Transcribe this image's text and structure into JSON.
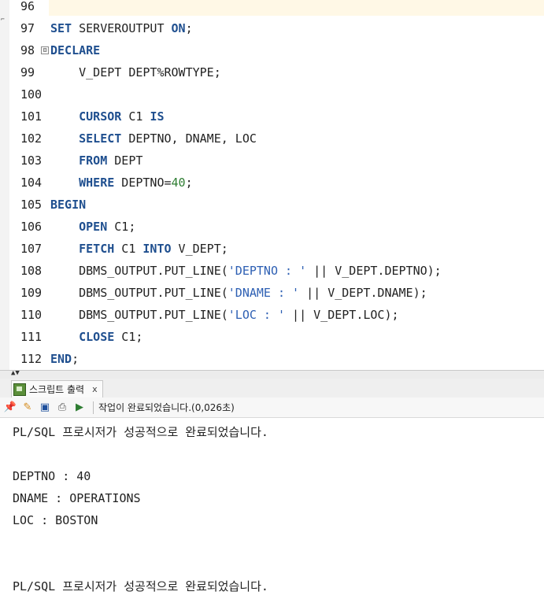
{
  "editor": {
    "lines": [
      {
        "num": "96",
        "segments": []
      },
      {
        "num": "97",
        "segments": [
          {
            "t": "SET",
            "c": "kw"
          },
          {
            "t": " SERVEROUTPUT ",
            "c": ""
          },
          {
            "t": "ON",
            "c": "kw"
          },
          {
            "t": ";",
            "c": ""
          }
        ]
      },
      {
        "num": "98",
        "segments": [
          {
            "t": "DECLARE",
            "c": "kw"
          }
        ]
      },
      {
        "num": "99",
        "segments": [
          {
            "t": "    V_DEPT DEPT%ROWTYPE;",
            "c": ""
          }
        ]
      },
      {
        "num": "100",
        "segments": []
      },
      {
        "num": "101",
        "segments": [
          {
            "t": "    ",
            "c": ""
          },
          {
            "t": "CURSOR",
            "c": "kw"
          },
          {
            "t": " C1 ",
            "c": ""
          },
          {
            "t": "IS",
            "c": "kw"
          }
        ]
      },
      {
        "num": "102",
        "segments": [
          {
            "t": "    ",
            "c": ""
          },
          {
            "t": "SELECT",
            "c": "kw"
          },
          {
            "t": " DEPTNO, DNAME, LOC",
            "c": ""
          }
        ]
      },
      {
        "num": "103",
        "segments": [
          {
            "t": "    ",
            "c": ""
          },
          {
            "t": "FROM",
            "c": "kw"
          },
          {
            "t": " DEPT",
            "c": ""
          }
        ]
      },
      {
        "num": "104",
        "segments": [
          {
            "t": "    ",
            "c": ""
          },
          {
            "t": "WHERE",
            "c": "kw"
          },
          {
            "t": " DEPTNO=",
            "c": ""
          },
          {
            "t": "40",
            "c": "num"
          },
          {
            "t": ";",
            "c": ""
          }
        ]
      },
      {
        "num": "105",
        "segments": [
          {
            "t": "BEGIN",
            "c": "kw"
          }
        ]
      },
      {
        "num": "106",
        "segments": [
          {
            "t": "    ",
            "c": ""
          },
          {
            "t": "OPEN",
            "c": "kw"
          },
          {
            "t": " C1;",
            "c": ""
          }
        ]
      },
      {
        "num": "107",
        "segments": [
          {
            "t": "    ",
            "c": ""
          },
          {
            "t": "FETCH",
            "c": "kw"
          },
          {
            "t": " C1 ",
            "c": ""
          },
          {
            "t": "INTO",
            "c": "kw"
          },
          {
            "t": " V_DEPT;",
            "c": ""
          }
        ]
      },
      {
        "num": "108",
        "segments": [
          {
            "t": "    DBMS_OUTPUT.PUT_LINE(",
            "c": ""
          },
          {
            "t": "'DEPTNO : '",
            "c": "str"
          },
          {
            "t": " || V_DEPT.DEPTNO);",
            "c": ""
          }
        ]
      },
      {
        "num": "109",
        "segments": [
          {
            "t": "    DBMS_OUTPUT.PUT_LINE(",
            "c": ""
          },
          {
            "t": "'DNAME : '",
            "c": "str"
          },
          {
            "t": " || V_DEPT.DNAME);",
            "c": ""
          }
        ]
      },
      {
        "num": "110",
        "segments": [
          {
            "t": "    DBMS_OUTPUT.PUT_LINE(",
            "c": ""
          },
          {
            "t": "'LOC : '",
            "c": "str"
          },
          {
            "t": " || V_DEPT.LOC);",
            "c": ""
          }
        ]
      },
      {
        "num": "111",
        "segments": [
          {
            "t": "    ",
            "c": ""
          },
          {
            "t": "CLOSE",
            "c": "kw"
          },
          {
            "t": " C1;",
            "c": ""
          }
        ]
      },
      {
        "num": "112",
        "segments": [
          {
            "t": "END",
            "c": "kw"
          },
          {
            "t": ";",
            "c": ""
          }
        ]
      }
    ],
    "fold_marker": "⊟",
    "colors": {
      "keyword": "#1f4f8f",
      "string": "#2d5fb3",
      "number": "#2e7d32",
      "current_line": "#fff8e6"
    }
  },
  "panel": {
    "tab_label": "스크립트 출력",
    "tab_close": "x",
    "status_text": "작업이 완료되었습니다.(0,026초)",
    "toolbar_icons": [
      "pin-icon",
      "eraser-icon",
      "save-icon",
      "print-icon",
      "run-icon"
    ]
  },
  "output": {
    "lines": [
      "PL/SQL 프로시저가 성공적으로 완료되었습니다.",
      "",
      "DEPTNO : 40",
      "DNAME : OPERATIONS",
      "LOC : BOSTON",
      "",
      "",
      "PL/SQL 프로시저가 성공적으로 완료되었습니다."
    ]
  }
}
